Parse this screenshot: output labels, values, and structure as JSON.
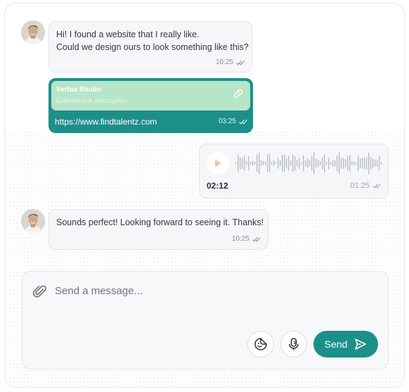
{
  "colors": {
    "accent": "#1d8f8a",
    "preview_bg": "#b7e5c8",
    "bubble_bg": "#f5f6f8"
  },
  "messages": [
    {
      "type": "text",
      "line1": "Hi! I found a website that I really like.",
      "line2": "Could we design ours to look something like this?",
      "time": "10:25"
    },
    {
      "type": "link",
      "title": "Vertaa Studio",
      "description": "External link description",
      "url": "https://www.findtalentz.com",
      "time": "03:25"
    },
    {
      "type": "voice",
      "duration": "02:12",
      "time": "01:25"
    },
    {
      "type": "text",
      "line1": "Sounds perfect! Looking forward to seeing it. Thanks!",
      "time": "10:25"
    }
  ],
  "composer": {
    "placeholder": "Send a message...",
    "send_label": "Send"
  },
  "icons": {
    "attach": "paperclip-icon",
    "sticker": "sticker-icon",
    "mic": "microphone-icon",
    "send": "send-icon",
    "link": "link-icon",
    "play": "play-icon",
    "read": "double-check-icon"
  }
}
